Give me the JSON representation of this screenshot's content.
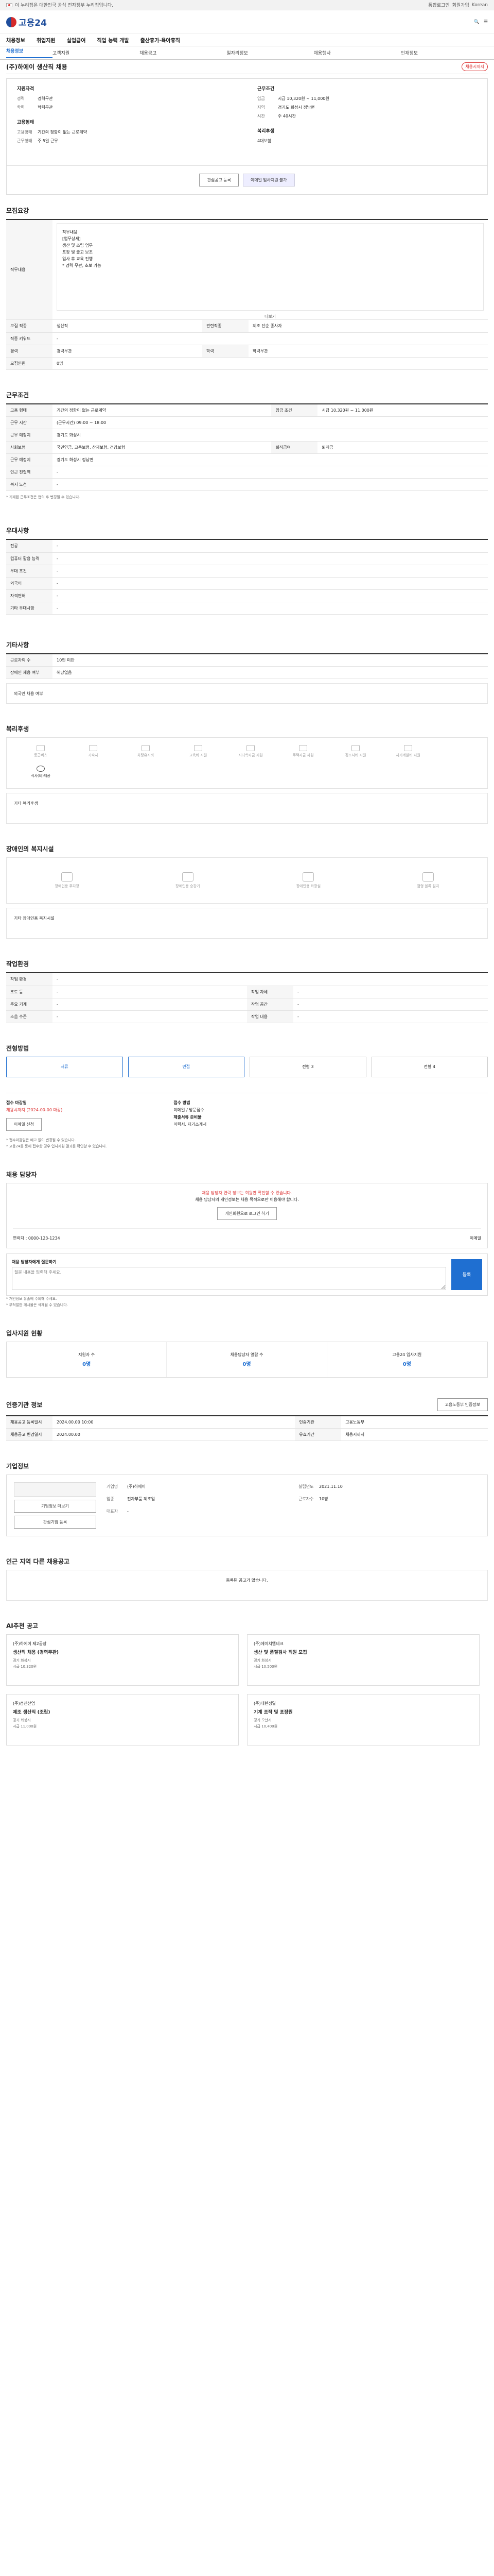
{
  "topbar": {
    "gov_text": "이 누리집은 대한민국 공식 전자정부 누리집입니다.",
    "login": "통합로그인",
    "join": "회원가입",
    "lang": "Korean"
  },
  "header": {
    "logo": "고용24"
  },
  "nav": [
    "채용정보",
    "취업지원",
    "실업급여",
    "직업 능력 개발",
    "출산휴가·육아휴직"
  ],
  "subnav": [
    "채용정보",
    "고객지원",
    "채용공고",
    "일자리정보",
    "채용행사",
    "인재정보"
  ],
  "job": {
    "title": "(주)하에이 생산직 채용",
    "status": "채용시까지"
  },
  "summary": {
    "left_title": "지원자격",
    "left": [
      {
        "k": "경력",
        "v": "경력무관"
      },
      {
        "k": "학력",
        "v": "학력무관"
      }
    ],
    "left2_title": "고용형태",
    "left2": [
      {
        "k": "고용형태",
        "v": "기간의 정함이 없는 근로계약"
      },
      {
        "k": "근무형태",
        "v": "주 5일 근무"
      }
    ],
    "right_title": "근무조건",
    "right": [
      {
        "k": "임금",
        "v": "시급 10,320원 ~ 11,000원"
      },
      {
        "k": "지역",
        "v": "경기도 화성시 정남면"
      },
      {
        "k": "시간",
        "v": "주 40시간"
      }
    ],
    "right2_title": "복리후생",
    "right2": [
      {
        "k": "",
        "v": "4대보험"
      }
    ],
    "buttons": [
      "관심공고 등록",
      "이메일 입사지원 불가"
    ]
  },
  "recruit": {
    "title": "모집요강",
    "desc_label": "직무내용",
    "desc": [
      "직무내용",
      "[업무상세]",
      "생산 및 조립 업무",
      "포장 및 출고 보조",
      "입사 후 교육 진행",
      "* 경력 무관, 초보 가능"
    ],
    "more": "더보기",
    "rows": [
      [
        "모집 직종",
        "생산직",
        "관련직종",
        "제조 단순 종사자"
      ],
      [
        "직종 키워드",
        "-",
        "",
        ""
      ],
      [
        "경력",
        "경력무관",
        "학력",
        "학력무관"
      ],
      [
        "모집인원",
        "0명",
        "",
        ""
      ]
    ]
  },
  "conditions": {
    "title": "근무조건",
    "rows": [
      [
        "고용 형태",
        "기간의 정함이 없는 근로계약",
        "임금 조건",
        "시급 10,320원 ~ 11,000원"
      ],
      [
        "근무 시간",
        "(근무시간) 09:00 ~ 18:00",
        "",
        ""
      ],
      [
        "근무 예정지",
        "경기도 화성시",
        "",
        ""
      ],
      [
        "사회보험",
        "국민연금, 고용보험, 산재보험, 건강보험",
        "퇴직급여",
        "퇴직금"
      ],
      [
        "근무 예정지",
        "경기도 화성시 정남면",
        "",
        ""
      ],
      [
        "인근 전철역",
        "-",
        "",
        ""
      ],
      [
        "복지 노선",
        "-",
        "",
        ""
      ]
    ],
    "note": "* 기재된 근무조건은 협의 후 변경될 수 있습니다."
  },
  "preference": {
    "title": "우대사항",
    "rows": [
      [
        "전공",
        "-"
      ],
      [
        "컴퓨터 활용 능력",
        "-"
      ],
      [
        "우대 조건",
        "-"
      ],
      [
        "외국어",
        "-"
      ],
      [
        "자격면허",
        "-"
      ],
      [
        "기타 우대사항",
        "-"
      ]
    ]
  },
  "etc": {
    "title": "기타사항",
    "rows": [
      [
        "근로자의 수",
        "10인 미만"
      ],
      [
        "장애인 채용 여부",
        "해당없음"
      ]
    ],
    "foreign": "외국인 채용 여부"
  },
  "welfare": {
    "title": "복리후생",
    "items": [
      "통근버스",
      "기숙사",
      "차량유지비",
      "교육비 지원",
      "자녀학자금 지원",
      "주택자금 지원",
      "경조사비 지원",
      "자기계발비 지원",
      "식사(비)제공"
    ],
    "active": 8,
    "other_label": "기타 복리후생"
  },
  "disabled": {
    "title": "장애인의 복지시설",
    "items": [
      "장애인용 주차장",
      "장애인용 승강기",
      "장애인용 화장실",
      "점형 블록 설치"
    ],
    "other_label": "기타 장애인용 복지시설"
  },
  "workenv": {
    "title": "작업환경",
    "rows": [
      [
        "작업 환경",
        "-",
        "",
        ""
      ],
      [
        "조도 등",
        "-",
        "작업 자세",
        "-"
      ],
      [
        "주요 기계",
        "-",
        "작업 공간",
        "-"
      ],
      [
        "소음 수준",
        "-",
        "작업 내용",
        "-"
      ]
    ]
  },
  "process": {
    "title": "전형방법",
    "steps": [
      "서류",
      "면접",
      "전형 3",
      "전형 4"
    ]
  },
  "apply": {
    "deadline_label": "접수 마감일",
    "deadline": "채용시까지 (2024-00-00 마감)",
    "method_label": "접수 방법",
    "method": "이메일 / 방문접수",
    "docs_label": "제출서류 준비물",
    "docs": "이력서, 자기소개서",
    "btn": "이메일 신청",
    "notes": [
      "* 접수마감일은 예고 없이 변경될 수 있습니다.",
      "* 고용24를 통해 접수한 경우 입사지원 결과를 확인할 수 있습니다."
    ]
  },
  "contact": {
    "title": "채용 담당자",
    "warn": "채용 담당자 연락 정보는 회원만 확인할 수 있습니다.",
    "warn2": "채용 담당자의 개인정보는 채용 목적으로만 이용해야 합니다.",
    "login_btn": "개인회원으로 로그인 하기",
    "phone_label": "연락처",
    "phone": "0000-123-1234",
    "email_label": "이메일",
    "q_label": "채용 담당자에게 질문하기",
    "q_placeholder": "질문 내용을 입력해 주세요.",
    "q_btn": "등록",
    "q_notes": [
      "* 개인정보 유출에 주의해 주세요.",
      "* 부적절한 게시물은 삭제될 수 있습니다."
    ]
  },
  "stats": {
    "title": "입사지원 현황",
    "items": [
      {
        "label": "지원자 수",
        "value": "0명"
      },
      {
        "label": "채용담당자 열람 수",
        "value": "0명"
      },
      {
        "label": "고용24 입사지원",
        "value": "0명"
      }
    ]
  },
  "info": {
    "title": "인증기관 정보",
    "rows": [
      [
        "채용공고 등록일시",
        "2024.00.00 10:00",
        "인증기관",
        "고용노동부"
      ],
      [
        "채용공고 변경일시",
        "2024.00.00",
        "유효기간",
        "채용시까지"
      ]
    ],
    "btn": "고용노동부 인증정보"
  },
  "company": {
    "title": "기업정보",
    "rows": [
      [
        "기업명",
        "(주)하에이"
      ],
      [
        "업종",
        "전자부품 제조업"
      ],
      [
        "대표자",
        "-"
      ]
    ],
    "right": [
      [
        "설립년도",
        "2021.11.10"
      ],
      [
        "근로자수",
        "10명"
      ]
    ],
    "btns": [
      "기업정보 더보기",
      "관심기업 등록"
    ]
  },
  "similar": {
    "title": "인근 지역 다른 채용공고",
    "none": "등록된 공고가 없습니다."
  },
  "rec": {
    "title": "AI추천 공고",
    "cards": [
      {
        "co": "(주)하에이 제2공장",
        "title": "생산직 채용 (경력무관)",
        "tag": "경기 화성시",
        "pay": "시급 10,320원"
      },
      {
        "co": "(주)에이치엠테크",
        "title": "생산 및 품질검사 직원 모집",
        "tag": "경기 화성시",
        "pay": "시급 10,500원"
      },
      {
        "co": "(주)성진산업",
        "title": "제조 생산직 (조립)",
        "tag": "경기 화성시",
        "pay": "시급 11,000원"
      },
      {
        "co": "(주)대한정밀",
        "title": "기계 조작 및 포장원",
        "tag": "경기 오산시",
        "pay": "시급 10,400원"
      }
    ]
  }
}
